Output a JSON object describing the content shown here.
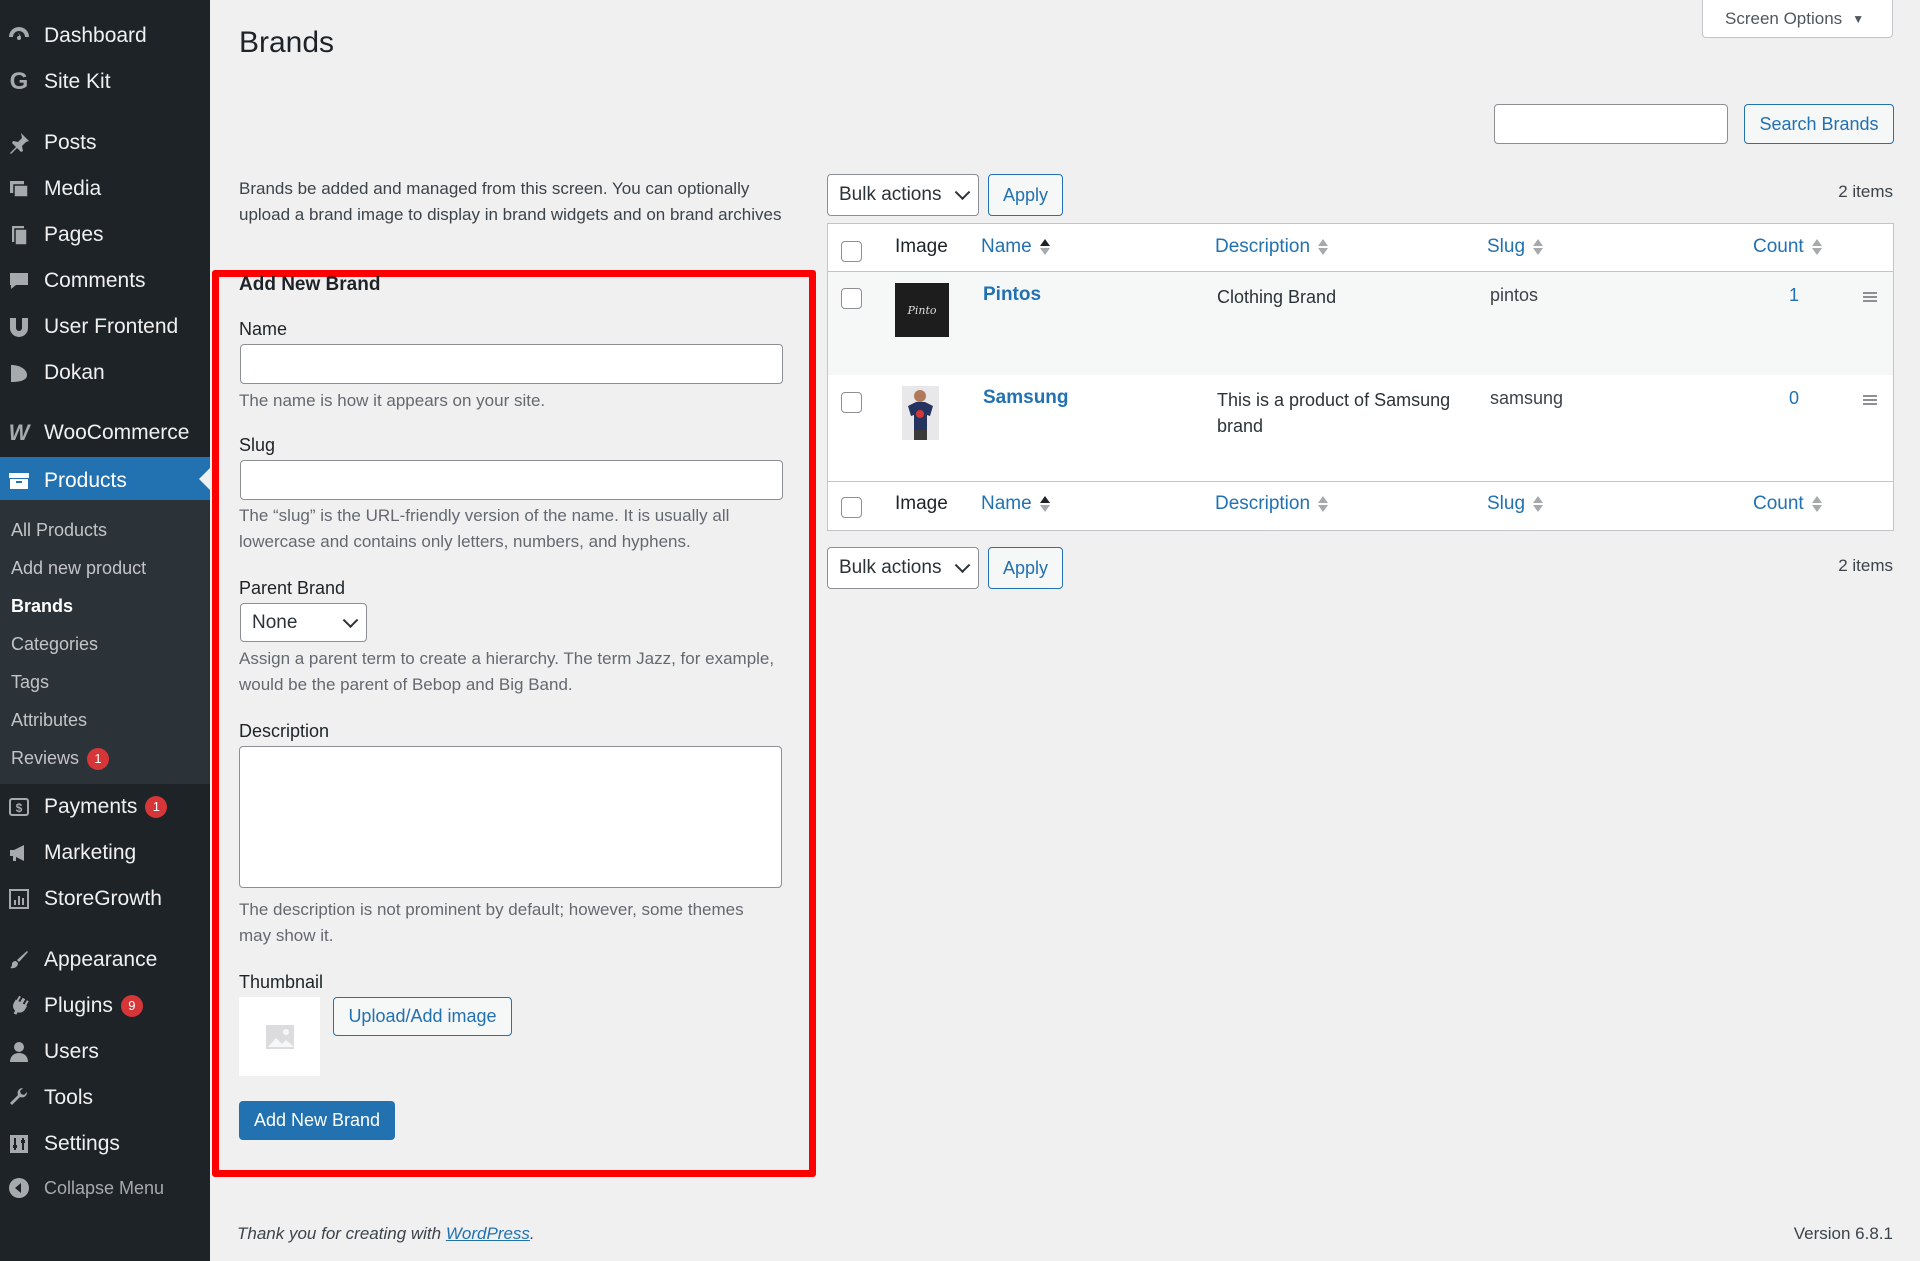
{
  "sidebar": {
    "items": [
      {
        "label": "Dashboard",
        "icon": "dashboard-icon"
      },
      {
        "label": "Site Kit",
        "icon": "google-g-icon"
      },
      {
        "label": "Posts",
        "icon": "pin-icon"
      },
      {
        "label": "Media",
        "icon": "media-icon"
      },
      {
        "label": "Pages",
        "icon": "pages-icon"
      },
      {
        "label": "Comments",
        "icon": "comment-icon"
      },
      {
        "label": "User Frontend",
        "icon": "user-frontend-icon"
      },
      {
        "label": "Dokan",
        "icon": "dokan-icon"
      },
      {
        "label": "WooCommerce",
        "icon": "woocommerce-icon"
      },
      {
        "label": "Products",
        "icon": "archive-box-icon"
      },
      {
        "label": "Payments",
        "icon": "dollar-icon",
        "badge": "1"
      },
      {
        "label": "Marketing",
        "icon": "megaphone-icon"
      },
      {
        "label": "StoreGrowth",
        "icon": "chart-icon"
      },
      {
        "label": "Appearance",
        "icon": "brush-icon"
      },
      {
        "label": "Plugins",
        "icon": "plug-icon",
        "badge": "9"
      },
      {
        "label": "Users",
        "icon": "user-icon"
      },
      {
        "label": "Tools",
        "icon": "wrench-icon"
      },
      {
        "label": "Settings",
        "icon": "settings-icon"
      },
      {
        "label": "Collapse Menu",
        "icon": "collapse-icon"
      }
    ],
    "submenu": [
      {
        "label": "All Products"
      },
      {
        "label": "Add new product"
      },
      {
        "label": "Brands"
      },
      {
        "label": "Categories"
      },
      {
        "label": "Tags"
      },
      {
        "label": "Attributes"
      },
      {
        "label": "Reviews",
        "badge": "1"
      }
    ]
  },
  "header": {
    "title": "Brands",
    "screen_options": "Screen Options",
    "search_button": "Search Brands"
  },
  "intro": "Brands be added and managed from this screen. You can optionally upload a brand image to display in brand widgets and on brand archives",
  "form": {
    "heading": "Add New Brand",
    "name_label": "Name",
    "name_value": "",
    "name_help": "The name is how it appears on your site.",
    "slug_label": "Slug",
    "slug_value": "",
    "slug_help": "The “slug” is the URL-friendly version of the name. It is usually all lowercase and contains only letters, numbers, and hyphens.",
    "parent_label": "Parent Brand",
    "parent_value": "None",
    "parent_help": "Assign a parent term to create a hierarchy. The term Jazz, for example, would be the parent of Bebop and Big Band.",
    "description_label": "Description",
    "description_value": "",
    "description_help": "The description is not prominent by default; however, some themes may show it.",
    "thumbnail_label": "Thumbnail",
    "upload_button": "Upload/Add image",
    "submit_button": "Add New Brand"
  },
  "table": {
    "bulk_actions": "Bulk actions",
    "apply": "Apply",
    "items_count": "2 items",
    "columns": {
      "image": "Image",
      "name": "Name",
      "description": "Description",
      "slug": "Slug",
      "count": "Count"
    },
    "rows": [
      {
        "name": "Pintos",
        "description": "Clothing Brand",
        "slug": "pintos",
        "count": "1",
        "thumb_text": "Pinto"
      },
      {
        "name": "Samsung",
        "description": "This is a product of Samsung brand",
        "slug": "samsung",
        "count": "0"
      }
    ]
  },
  "footer": {
    "thanks_prefix": "Thank you for creating with ",
    "wordpress_link": "WordPress",
    "thanks_suffix": ".",
    "version": "Version 6.8.1"
  },
  "colors": {
    "admin_bar": "#1d2327",
    "accent": "#2271b1",
    "highlight_box": "#ff0000",
    "badge": "#d63638"
  }
}
